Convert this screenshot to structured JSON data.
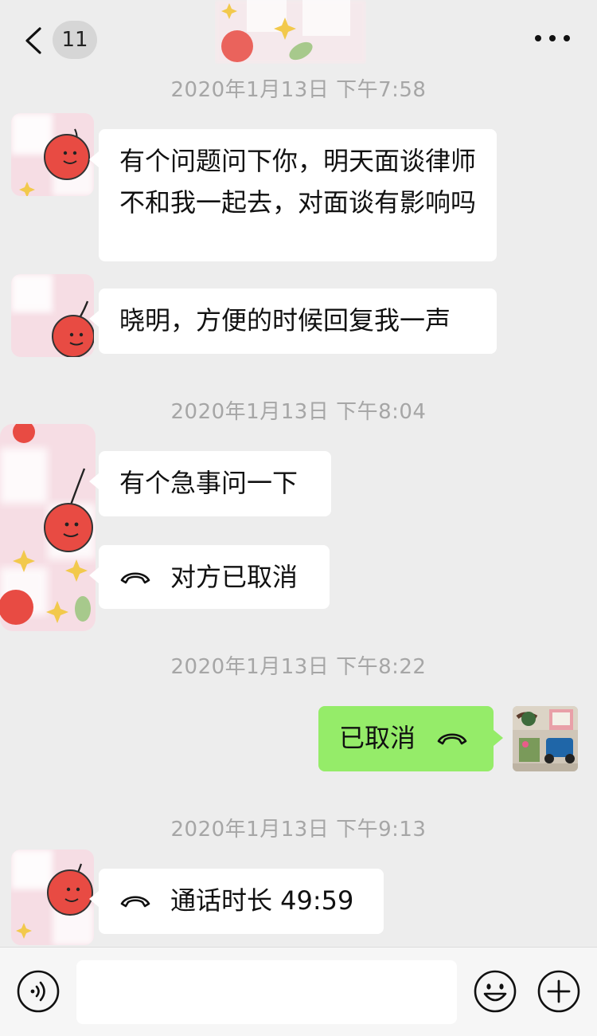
{
  "header": {
    "back_count": "11",
    "title": ""
  },
  "messages": [
    {
      "timestamp": "2020年1月13日 下午7:58"
    },
    {
      "text": "有个问题问下你，明天面谈律师不和我一起去，对面谈有影响吗"
    },
    {
      "text": "晓明，方便的时候回复我一声"
    },
    {
      "timestamp": "2020年1月13日 下午8:04"
    },
    {
      "text": "有个急事问一下"
    },
    {
      "text": "对方已取消",
      "icon": "phone-hangup-icon"
    },
    {
      "timestamp": "2020年1月13日 下午8:22"
    },
    {
      "text": "已取消",
      "icon": "phone-hangup-icon"
    },
    {
      "timestamp": "2020年1月13日 下午9:13"
    },
    {
      "text": "通话时长 49:59",
      "icon": "phone-hangup-icon"
    }
  ],
  "input": {
    "value": "",
    "placeholder": ""
  },
  "icons": {
    "back": "chevron-left-icon",
    "more": "more-dots-icon",
    "voice": "voice-icon",
    "emoji": "emoji-icon",
    "plus": "plus-icon"
  },
  "colors": {
    "background": "#ededed",
    "bubble_incoming": "#ffffff",
    "bubble_outgoing": "#95ec69",
    "timestamp": "#a6a6a6"
  }
}
